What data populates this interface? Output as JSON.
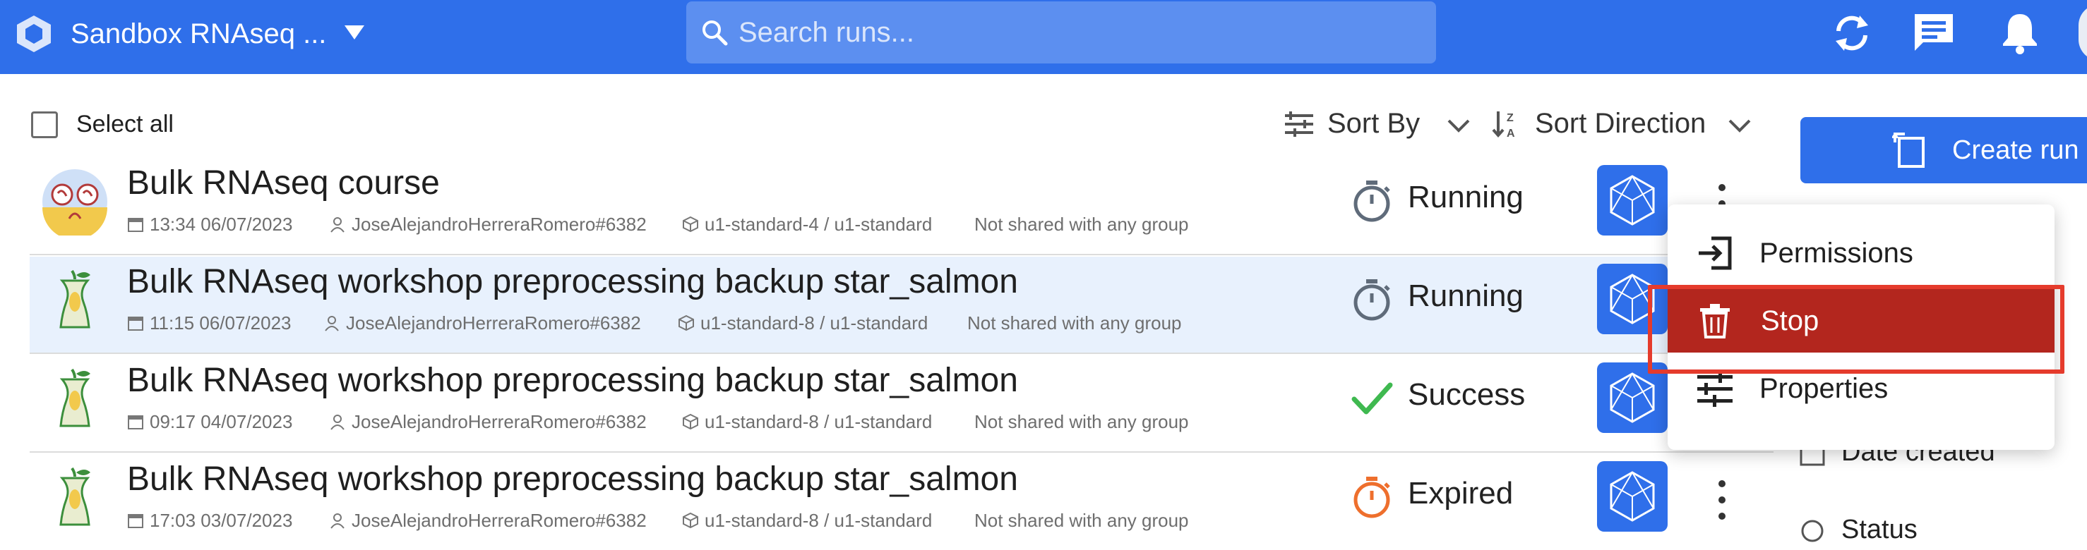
{
  "header": {
    "workspace_title": "Sandbox RNAseq ...",
    "search_placeholder": "Search runs..."
  },
  "toolbar": {
    "select_all_label": "Select all",
    "sort_by_label": "Sort By",
    "sort_direction_label": "Sort Direction",
    "create_run_label": "Create run"
  },
  "sort_options_partial": [
    {
      "label": "Date created",
      "icon": "calendar-icon"
    },
    {
      "label": "Status",
      "icon": "radio-icon"
    }
  ],
  "runs": [
    {
      "title": "Bulk RNAseq course",
      "datetime": "13:34 06/07/2023",
      "owner": "JoseAlejandroHerreraRomero#6382",
      "instance": "u1-standard-4 / u1-standard",
      "sharing": "Not shared with any group",
      "status": "Running",
      "status_icon": "stopwatch-icon",
      "avatar": "course-avatar"
    },
    {
      "title": "Bulk RNAseq workshop preprocessing backup star_salmon",
      "datetime": "11:15 06/07/2023",
      "owner": "JoseAlejandroHerreraRomero#6382",
      "instance": "u1-standard-8 / u1-standard",
      "sharing": "Not shared with any group",
      "status": "Running",
      "status_icon": "stopwatch-icon",
      "avatar": "apple-core-avatar"
    },
    {
      "title": "Bulk RNAseq workshop preprocessing backup star_salmon",
      "datetime": "09:17 04/07/2023",
      "owner": "JoseAlejandroHerreraRomero#6382",
      "instance": "u1-standard-8 / u1-standard",
      "sharing": "Not shared with any group",
      "status": "Success",
      "status_icon": "check-icon",
      "avatar": "apple-core-avatar"
    },
    {
      "title": "Bulk RNAseq workshop preprocessing backup star_salmon",
      "datetime": "17:03 03/07/2023",
      "owner": "JoseAlejandroHerreraRomero#6382",
      "instance": "u1-standard-8 / u1-standard",
      "sharing": "Not shared with any group",
      "status": "Expired",
      "status_icon": "stopwatch-icon",
      "avatar": "apple-core-avatar"
    }
  ],
  "context_menu": {
    "items": [
      {
        "label": "Permissions",
        "icon": "permissions-icon"
      },
      {
        "label": "Stop",
        "icon": "trash-icon"
      },
      {
        "label": "Properties",
        "icon": "sliders-icon"
      }
    ]
  },
  "colors": {
    "brand_blue": "#2f6fea",
    "danger_red": "#b3261e",
    "focus_ring": "#e53b2c",
    "success_green": "#3fb950",
    "expired_orange": "#ee6f2d",
    "running_gray": "#5f6b7a",
    "row_highlight": "#e8f1fd"
  }
}
